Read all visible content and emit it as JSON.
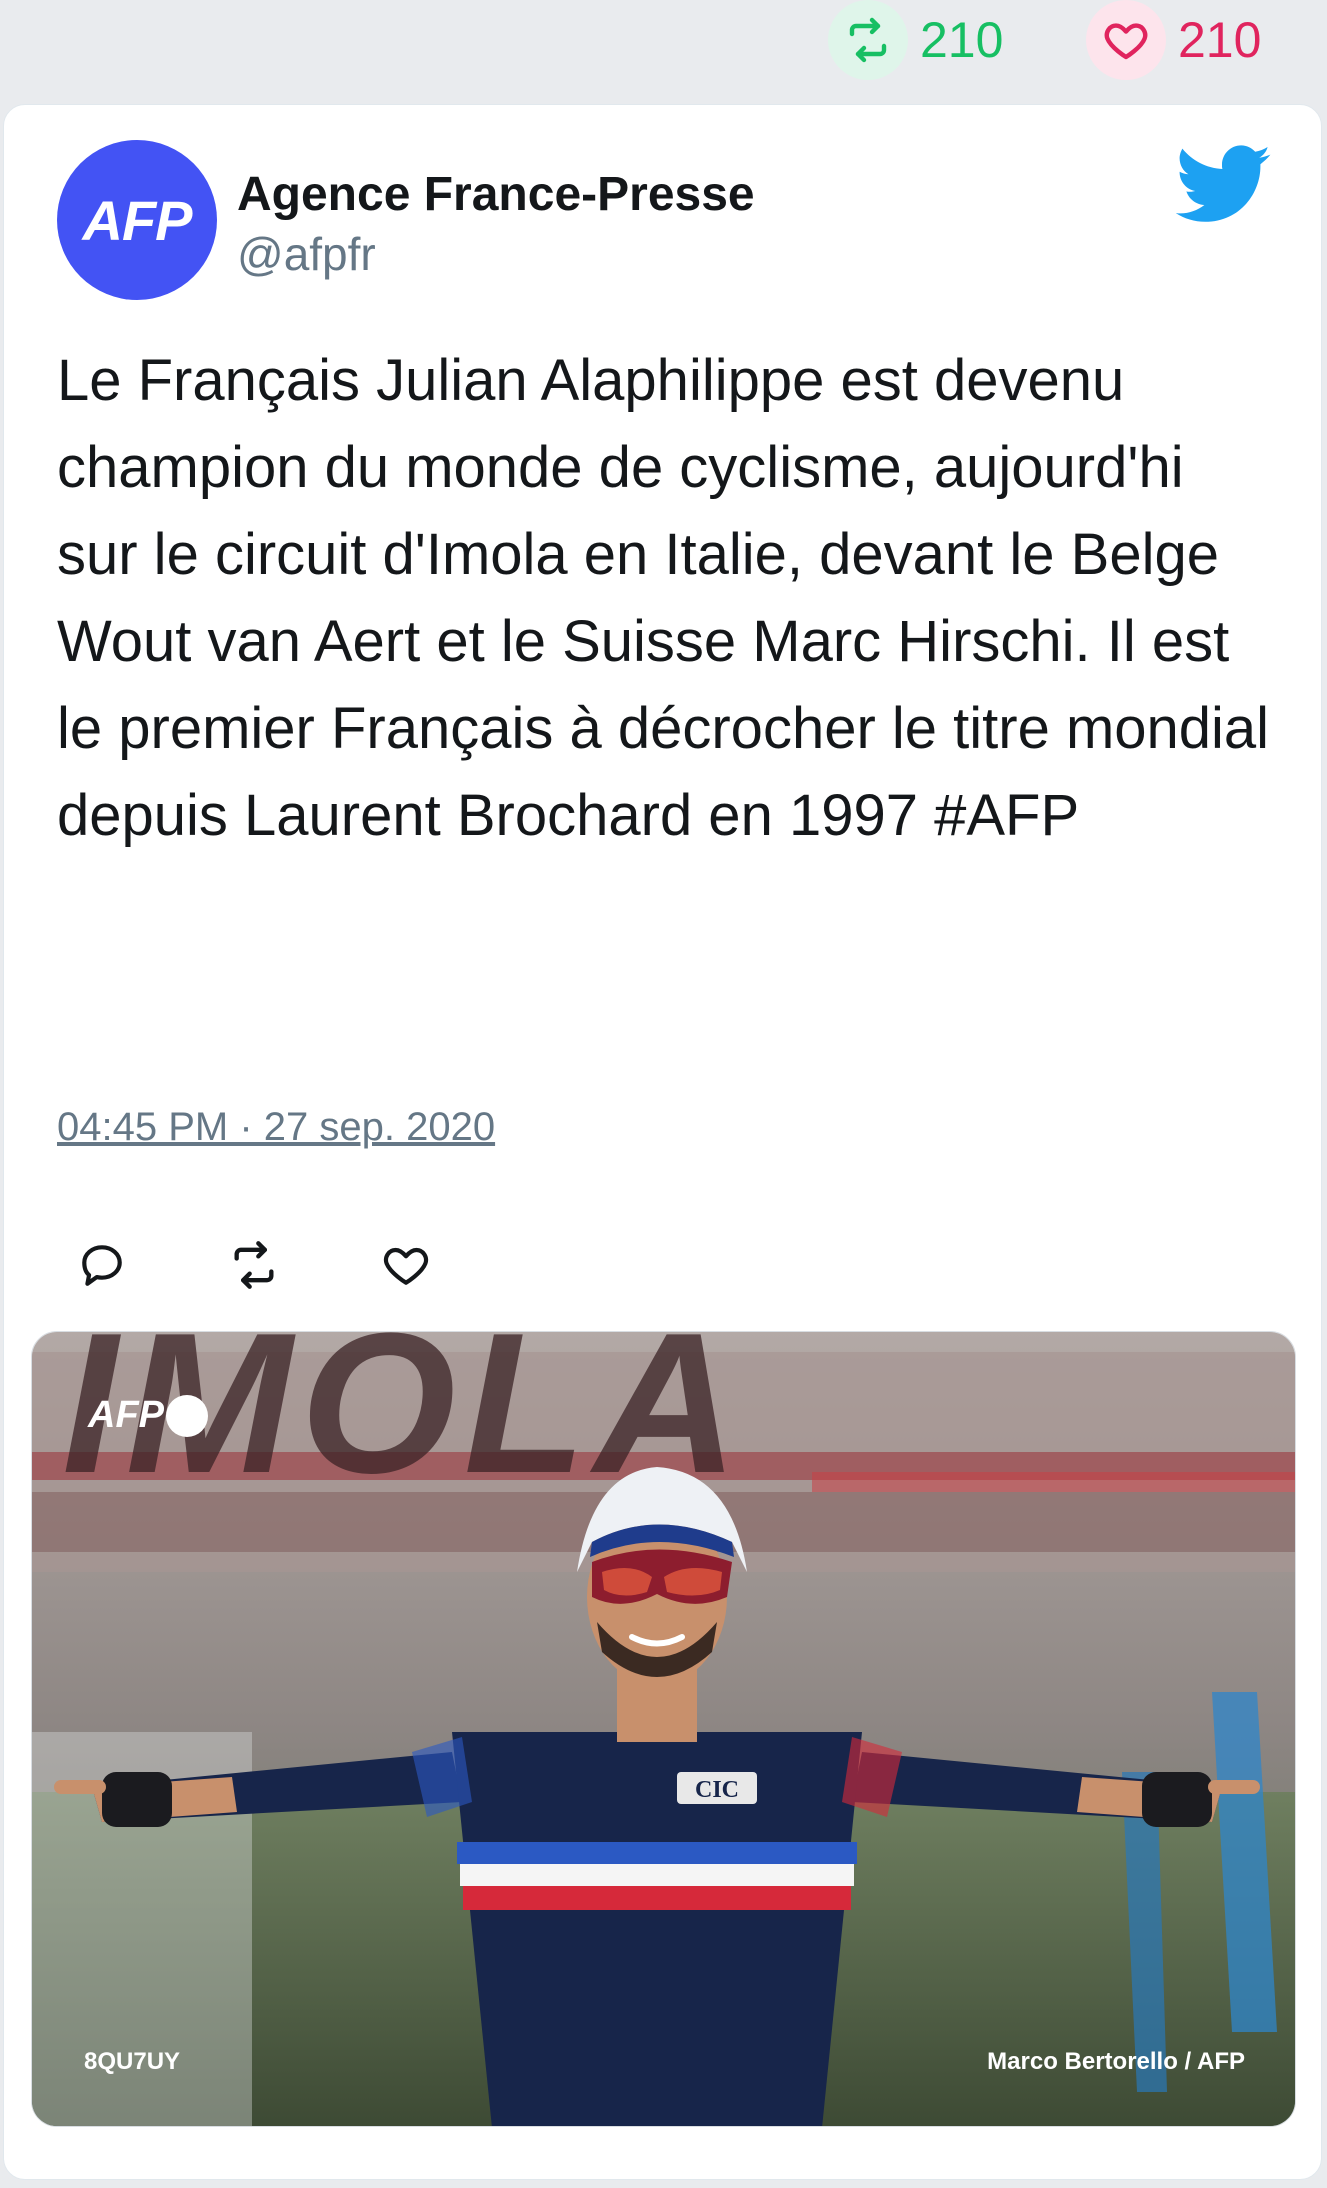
{
  "stats": {
    "retweets": "210",
    "likes": "210"
  },
  "tweet": {
    "author_name": "Agence France-Presse",
    "author_handle": "@afpfr",
    "avatar_text": "AFP",
    "text": "Le Français Julian Alaphilippe est devenu champion du monde de cyclisme, aujourd'hi sur le circuit d'Imola en Italie, devant le Belge Wout van Aert et le Suisse Marc Hirschi. Il est le premier Français à décrocher le titre mondial depuis Laurent Brochard en 1997 #AFP",
    "timestamp": "04:45 PM · 27 sep. 2020"
  },
  "media": {
    "banner_text": "IMOLA",
    "watermark": "AFP",
    "code": "8QU7UY",
    "credit": "Marco Bertorello / AFP",
    "jersey_sponsor": "CIC"
  },
  "icons": {
    "retweet": "retweet-icon",
    "like": "heart-icon",
    "reply": "reply-icon",
    "brand": "twitter-bird-icon"
  },
  "colors": {
    "retweet": "#17bf63",
    "like": "#e0245e",
    "avatar_bg": "#4353f4",
    "twitter_blue": "#1da1f2",
    "muted": "#657786",
    "text": "#14171a"
  }
}
